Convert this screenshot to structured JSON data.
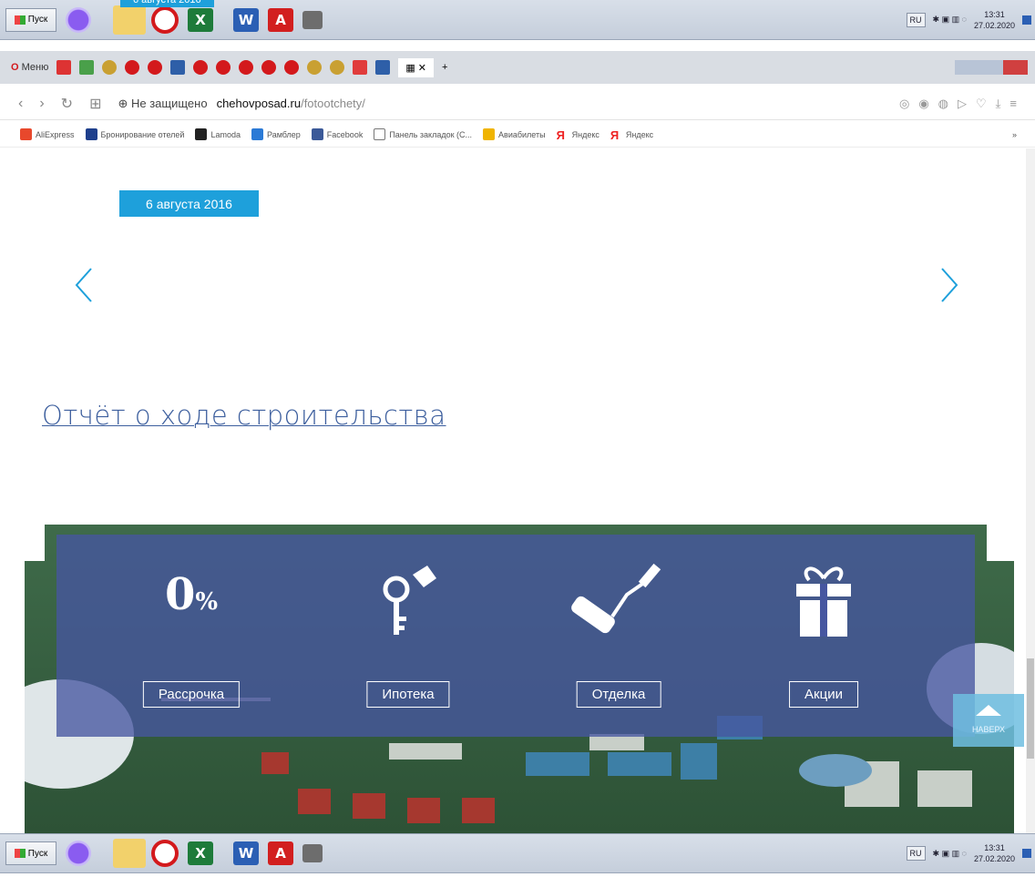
{
  "colors": {
    "accent": "#1ea0db",
    "link": "#3d5f9e",
    "panel": "#4656a0"
  },
  "taskbar": {
    "start_label": "Пуск",
    "lang": "RU",
    "time": "13:31",
    "date": "27.02.2020",
    "apps": [
      "alice-icon",
      "folder-icon",
      "opera-icon",
      "excel-icon",
      "word-icon",
      "acrobat-icon",
      "printer-icon"
    ]
  },
  "browser": {
    "menu_label": "Меню",
    "address": {
      "security": "Не защищено",
      "domain": "chehovposad.ru",
      "path": "/fotootchety/"
    },
    "bookmarks": [
      "AliExpress",
      "Бронирование отелей",
      "Lamoda",
      "Рамблер",
      "Facebook",
      "Панель закладок (С...",
      "Авиабилеты",
      "Яндекс",
      "Яндекс"
    ],
    "bookmarks_more": "»"
  },
  "page": {
    "top_date": "6 августа 2016",
    "date_badge": "6 августа 2016",
    "report_link": "Отчёт о ходе строительства",
    "features": [
      {
        "label": "Рассрочка",
        "icon": "zero-percent-icon"
      },
      {
        "label": "Ипотека",
        "icon": "key-icon"
      },
      {
        "label": "Отделка",
        "icon": "paint-roller-icon"
      },
      {
        "label": "Акции",
        "icon": "gift-icon"
      }
    ],
    "zero_text": "0",
    "percent_text": "%",
    "up_button_label": "НАВЕРХ"
  }
}
